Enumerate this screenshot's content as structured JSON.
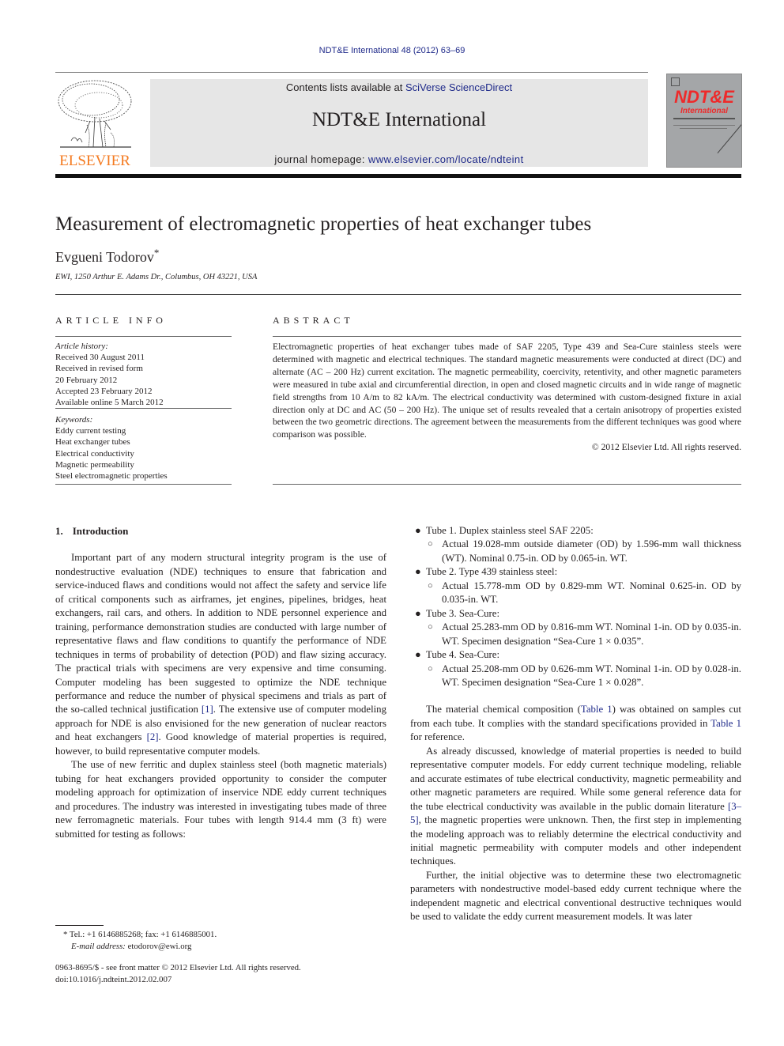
{
  "header": {
    "journal_ref": "NDT&E International 48 (2012) 63–69",
    "contents_prefix": "Contents lists available at ",
    "contents_link": "SciVerse ScienceDirect",
    "journal_title": "NDT&E International",
    "homepage_prefix": "journal homepage: ",
    "homepage_link": "www.elsevier.com/locate/ndteint",
    "publisher_logo_text": "ELSEVIER",
    "cover_title": "NDT&E",
    "cover_subtitle": "International",
    "colors": {
      "link": "#1f2a8a",
      "elsevier_orange": "#f47a20",
      "cover_red": "#ee2a2a",
      "banner_gray": "#e6e6e6"
    }
  },
  "article": {
    "title": "Measurement of electromagnetic properties of heat exchanger tubes",
    "author": "Evgueni Todorov",
    "author_mark": "*",
    "affiliation": "EWI, 1250 Arthur E. Adams Dr., Columbus, OH 43221, USA"
  },
  "article_info": {
    "heading": "ARTICLE INFO",
    "history_label": "Article history:",
    "history": [
      "Received 30 August 2011",
      "Received in revised form",
      "20 February 2012",
      "Accepted 23 February 2012",
      "Available online 5 March 2012"
    ],
    "keywords_label": "Keywords:",
    "keywords": [
      "Eddy current testing",
      "Heat exchanger tubes",
      "Electrical conductivity",
      "Magnetic permeability",
      "Steel electromagnetic properties"
    ]
  },
  "abstract": {
    "heading": "ABSTRACT",
    "text": "Electromagnetic properties of heat exchanger tubes made of SAF 2205, Type 439 and Sea-Cure stainless steels were determined with magnetic and electrical techniques. The standard magnetic measurements were conducted at direct (DC) and alternate (AC – 200 Hz) current excitation. The magnetic permeability, coercivity, retentivity, and other magnetic parameters were measured in tube axial and circumferential direction, in open and closed magnetic circuits and in wide range of magnetic field strengths from 10 A/m to 82 kA/m. The electrical conductivity was determined with custom-designed fixture in axial direction only at DC and AC (50 – 200 Hz). The unique set of results revealed that a certain anisotropy of properties existed between the two geometric directions. The agreement between the measurements from the different techniques was good where comparison was possible.",
    "copyright": "© 2012 Elsevier Ltd. All rights reserved."
  },
  "intro": {
    "number": "1.",
    "heading": "Introduction",
    "p1_a": "Important part of any modern structural integrity program is the use of nondestructive evaluation (NDE) techniques to ensure that fabrication and service-induced flaws and conditions would not affect the safety and service life of critical components such as airframes, jet engines, pipelines, bridges, heat exchangers, rail cars, and others. In addition to NDE personnel experience and training, performance demonstration studies are conducted with large number of representative flaws and flaw conditions to quantify the performance of NDE techniques in terms of probability of detection (POD) and flaw sizing accuracy. The practical trials with specimens are very expensive and time consuming. Computer modeling has been suggested to optimize the NDE technique performance and reduce the number of physical specimens and trials as part of the so-called technical justification ",
    "ref1": "[1]",
    "p1_b": ". The extensive use of computer modeling approach for NDE is also envisioned for the new generation of nuclear reactors and heat exchangers ",
    "ref2": "[2]",
    "p1_c": ". Good knowledge of material properties is required, however, to build representative computer models.",
    "p2": "The use of new ferritic and duplex stainless steel (both magnetic materials) tubing for heat exchangers provided opportunity to consider the computer modeling approach for optimization of inservice NDE eddy current techniques and procedures. The industry was interested in investigating tubes made of three new ferromagnetic materials. Four tubes with length 914.4 mm (3 ft) were submitted for testing as follows:"
  },
  "tubes": [
    {
      "label": "Tube 1. Duplex stainless steel SAF 2205:",
      "detail": "Actual 19.028-mm outside diameter (OD) by 1.596-mm wall thickness (WT). Nominal 0.75-in. OD by 0.065-in. WT."
    },
    {
      "label": "Tube 2. Type 439 stainless steel:",
      "detail": "Actual 15.778-mm OD by 0.829-mm WT. Nominal 0.625-in. OD by 0.035-in. WT."
    },
    {
      "label": "Tube 3. Sea-Cure:",
      "detail": "Actual 25.283-mm OD by 0.816-mm WT. Nominal 1-in. OD by 0.035-in. WT. Specimen designation “Sea-Cure 1 × 0.035”."
    },
    {
      "label": "Tube 4. Sea-Cure:",
      "detail": "Actual 25.208-mm OD by 0.626-mm WT. Nominal 1-in. OD by 0.028-in. WT. Specimen designation “Sea-Cure 1 × 0.028”."
    }
  ],
  "right": {
    "p1_a": "The material chemical composition (",
    "table_ref_1": "Table 1",
    "p1_b": ") was obtained on samples cut from each tube. It complies with the standard specifications provided in ",
    "table_ref_2": "Table 1",
    "p1_c": " for reference.",
    "p2_a": "As already discussed, knowledge of material properties is needed to build representative computer models. For eddy current technique modeling, reliable and accurate estimates of tube electrical conductivity, magnetic permeability and other magnetic parameters are required. While some general reference data for the tube electrical conductivity was available in the public domain literature ",
    "ref35": "[3–5]",
    "p2_b": ", the magnetic properties were unknown. Then, the first step in implementing the modeling approach was to reliably determine the electrical conductivity and initial magnetic permeability with computer models and other independent techniques.",
    "p3": "Further, the initial objective was to determine these two electromagnetic parameters with nondestructive model-based eddy current technique where the independent magnetic and electrical conventional destructive techniques would be used to validate the eddy current measurement models. It was later"
  },
  "footnote": {
    "contact": "* Tel.: +1 6146885268; fax: +1 6146885001.",
    "email_label": "E-mail address: ",
    "email": "etodorov@ewi.org",
    "front_matter": "0963-8695/$ - see front matter © 2012 Elsevier Ltd. All rights reserved.",
    "doi": "doi:10.1016/j.ndteint.2012.02.007"
  }
}
